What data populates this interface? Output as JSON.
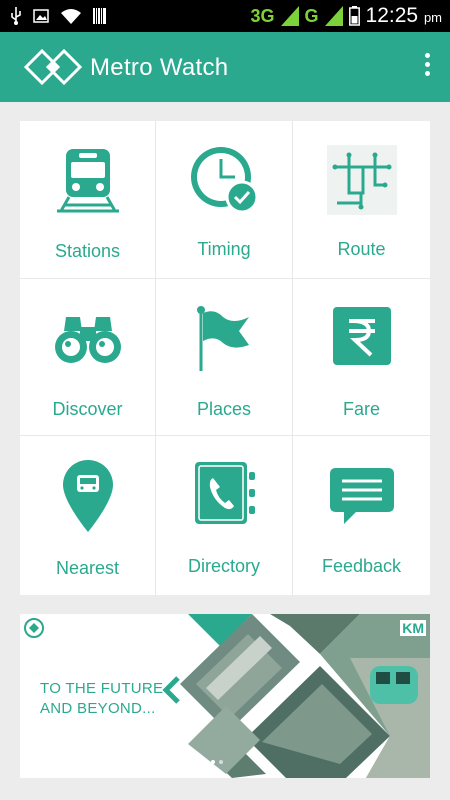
{
  "status_bar": {
    "network": "3G",
    "network2": "G",
    "time": "12:25",
    "ampm": "pm"
  },
  "app_bar": {
    "title": "Metro Watch"
  },
  "menu": [
    {
      "label": "Stations",
      "icon": "train-icon"
    },
    {
      "label": "Timing",
      "icon": "clock-check-icon"
    },
    {
      "label": "Route",
      "icon": "route-map-icon"
    },
    {
      "label": "Discover",
      "icon": "binoculars-icon"
    },
    {
      "label": "Places",
      "icon": "flag-icon"
    },
    {
      "label": "Fare",
      "icon": "rupee-icon"
    },
    {
      "label": "Nearest",
      "icon": "location-pin-icon"
    },
    {
      "label": "Directory",
      "icon": "phone-book-icon"
    },
    {
      "label": "Feedback",
      "icon": "message-icon"
    }
  ],
  "banner": {
    "line1": "TO THE FUTURE",
    "line2": "AND BEYOND...",
    "brand_mark": "KM"
  },
  "colors": {
    "accent": "#2aa98f",
    "status_bar": "#000000",
    "network": "#7dd13a"
  }
}
